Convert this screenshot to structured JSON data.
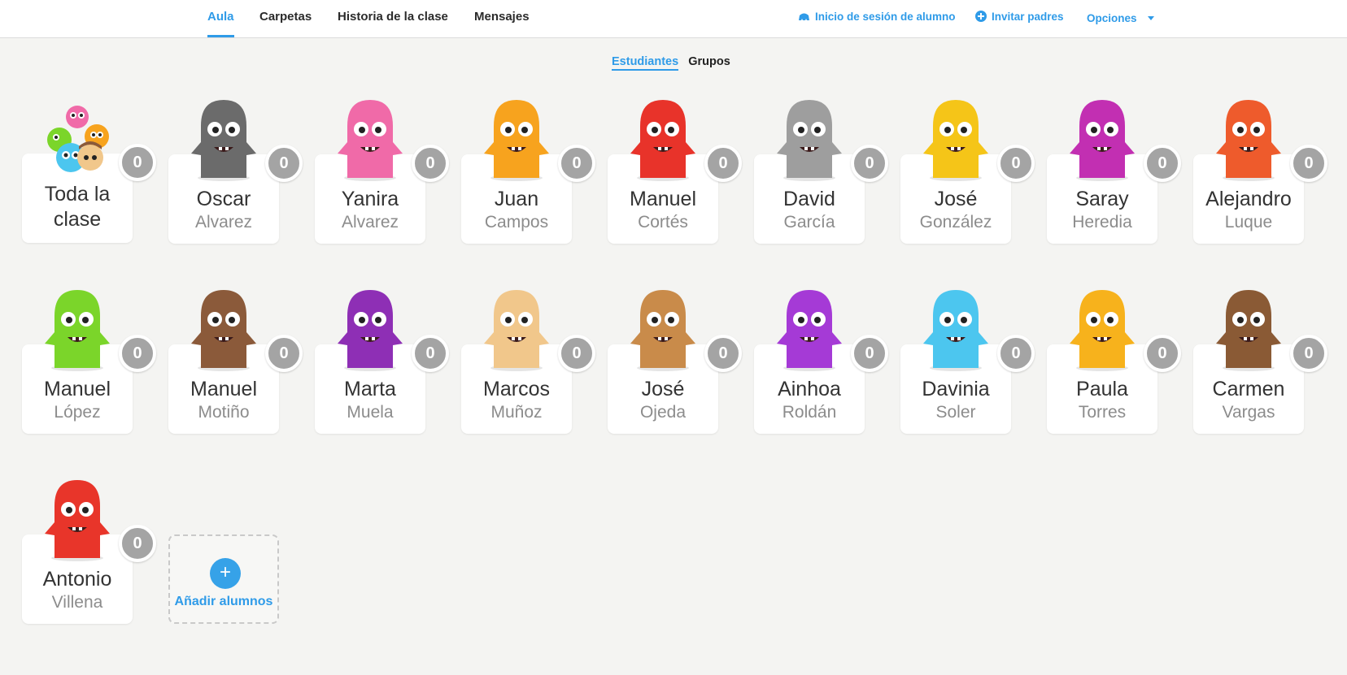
{
  "nav": {
    "tabs": [
      {
        "label": "Aula",
        "active": true
      },
      {
        "label": "Carpetas",
        "active": false
      },
      {
        "label": "Historia de la clase",
        "active": false
      },
      {
        "label": "Mensajes",
        "active": false
      }
    ],
    "student_login": "Inicio de sesión de alumno",
    "invite_parents": "Invitar padres",
    "options": "Opciones"
  },
  "subtabs": {
    "students": "Estudiantes",
    "groups": "Grupos"
  },
  "whole_class": {
    "line1": "Toda la",
    "line2": "clase",
    "points": "0"
  },
  "students": [
    {
      "first": "Oscar",
      "last": "Alvarez",
      "points": "0",
      "avatar_color": "#6b6b6b"
    },
    {
      "first": "Yanira",
      "last": "Alvarez",
      "points": "0",
      "avatar_color": "#f06aa8"
    },
    {
      "first": "Juan",
      "last": "Campos",
      "points": "0",
      "avatar_color": "#f7a31e"
    },
    {
      "first": "Manuel",
      "last": "Cortés",
      "points": "0",
      "avatar_color": "#e8332a"
    },
    {
      "first": "David",
      "last": "García",
      "points": "0",
      "avatar_color": "#9e9e9e"
    },
    {
      "first": "José",
      "last": "González",
      "points": "0",
      "avatar_color": "#f5c518"
    },
    {
      "first": "Saray",
      "last": "Heredia",
      "points": "0",
      "avatar_color": "#c22fb2"
    },
    {
      "first": "Alejandro",
      "last": "Luque",
      "points": "0",
      "avatar_color": "#ee5b2c"
    },
    {
      "first": "Manuel",
      "last": "López",
      "points": "0",
      "avatar_color": "#7bd52a"
    },
    {
      "first": "Manuel",
      "last": "Motiño",
      "points": "0",
      "avatar_color": "#8b5a3a"
    },
    {
      "first": "Marta",
      "last": "Muela",
      "points": "0",
      "avatar_color": "#8e2fb5"
    },
    {
      "first": "Marcos",
      "last": "Muñoz",
      "points": "0",
      "avatar_color": "#f1c78b"
    },
    {
      "first": "José",
      "last": "Ojeda",
      "points": "0",
      "avatar_color": "#c98b4a"
    },
    {
      "first": "Ainhoa",
      "last": "Roldán",
      "points": "0",
      "avatar_color": "#a53ad6"
    },
    {
      "first": "Davinia",
      "last": "Soler",
      "points": "0",
      "avatar_color": "#4cc6ef"
    },
    {
      "first": "Paula",
      "last": "Torres",
      "points": "0",
      "avatar_color": "#f7b21c"
    },
    {
      "first": "Carmen",
      "last": "Vargas",
      "points": "0",
      "avatar_color": "#8a5a35"
    },
    {
      "first": "Antonio",
      "last": "Villena",
      "points": "0",
      "avatar_color": "#e8352a"
    }
  ],
  "add_students": {
    "label": "Añadir alumnos",
    "icon": "plus-icon"
  },
  "colors": {
    "accent": "#2f9be8",
    "badge": "#a4a4a4",
    "background": "#f4f4f2"
  }
}
